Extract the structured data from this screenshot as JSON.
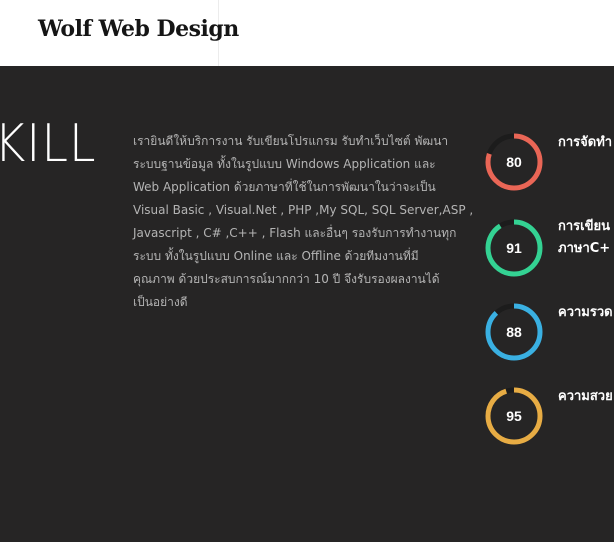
{
  "header": {
    "logo_text": "Wolf Web Design"
  },
  "section": {
    "title": "KILL",
    "description_lines": [
      "เรายินดีให้บริการงาน รับเขียนโปรแกรม รับทำเว็บไซต์ พัฒนา",
      "ระบบฐานข้อมูล ทั้งในรูปแบบ Windows Application และ",
      "Web Application ด้วยภาษาที่ใช้ในการพัฒนาในว่าจะเป็น",
      "Visual Basic , Visual.Net , PHP ,My SQL, SQL Server,ASP ,",
      "Javascript , C# ,C++ , Flash และอื่นๆ รองรับการทำงานทุก",
      "ระบบ ทั้งในรูปแบบ Online และ Offline ด้วยทีมงานที่มี",
      "คุณภาพ ด้วยประสบการณ์มากกว่า 10 ปี จึงรับรองผลงานได้",
      "เป็นอย่างดี"
    ]
  },
  "skills": [
    {
      "value": "80",
      "percent": 80,
      "color": "#e96656",
      "label_lines": [
        "การจัดทำ"
      ]
    },
    {
      "value": "91",
      "percent": 91,
      "color": "#34d293",
      "label_lines": [
        "การเขียน",
        "ภาษาC+"
      ]
    },
    {
      "value": "88",
      "percent": 88,
      "color": "#3ab0e2",
      "label_lines": [
        "ความรวด"
      ]
    },
    {
      "value": "95",
      "percent": 95,
      "color": "#e7ac44",
      "label_lines": [
        "ความสวย"
      ]
    }
  ]
}
